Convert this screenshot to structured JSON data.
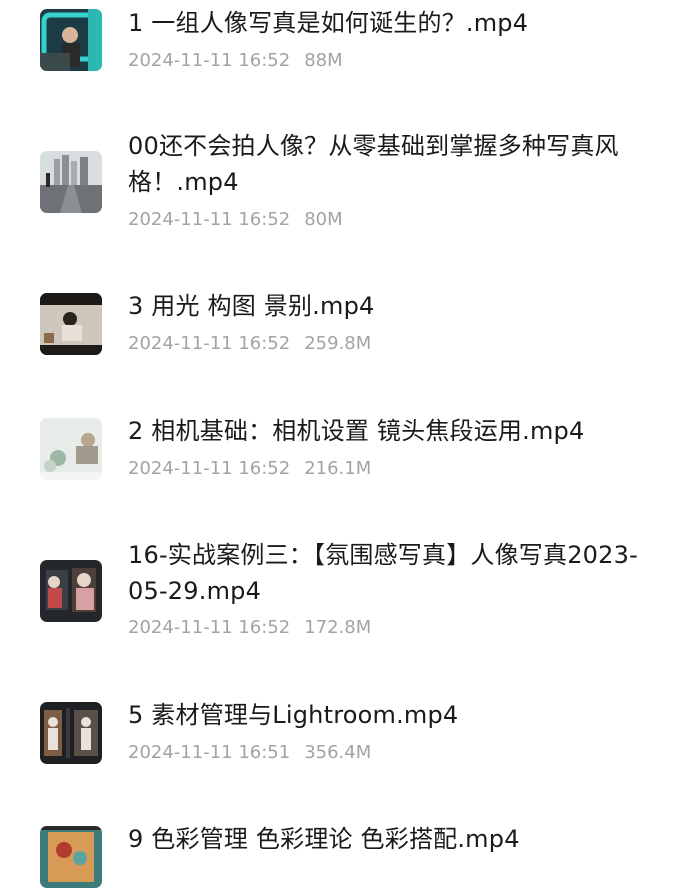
{
  "files": [
    {
      "title": "1 一组人像写真是如何诞生的？.mp4",
      "date": "2024-11-11 16:52",
      "size": "88M",
      "thumb_colors": [
        "#1b3b45",
        "#38d2cc",
        "#2a2a2a"
      ]
    },
    {
      "title": "00还不会拍人像？从零基础到掌握多种写真风格！.mp4",
      "date": "2024-11-11 16:52",
      "size": "80M",
      "thumb_colors": [
        "#c9cdd1",
        "#7d8288",
        "#545454"
      ]
    },
    {
      "title": "3 用光 构图 景别.mp4",
      "date": "2024-11-11 16:52",
      "size": "259.8M",
      "thumb_colors": [
        "#3c3129",
        "#cfc6bc",
        "#2a2420"
      ]
    },
    {
      "title": "2 相机基础：相机设置 镜头焦段运用.mp4",
      "date": "2024-11-11 16:52",
      "size": "216.1M",
      "thumb_colors": [
        "#e7ece9",
        "#9db6a6",
        "#b7a58f"
      ]
    },
    {
      "title": "16-实战案例三：【氛围感写真】人像写真2023-05-29.mp4",
      "date": "2024-11-11 16:52",
      "size": "172.8M",
      "thumb_colors": [
        "#23272b",
        "#c24a4a",
        "#e6d5c8"
      ]
    },
    {
      "title": "5 素材管理与Lightroom.mp4",
      "date": "2024-11-11 16:51",
      "size": "356.4M",
      "thumb_colors": [
        "#1f2023",
        "#7d5d46",
        "#e8e2da"
      ]
    },
    {
      "title": "9 色彩管理 色彩理论 色彩搭配.mp4",
      "date": "",
      "size": "",
      "thumb_colors": [
        "#d89a57",
        "#3b7c7a",
        "#b13b2f"
      ]
    }
  ]
}
